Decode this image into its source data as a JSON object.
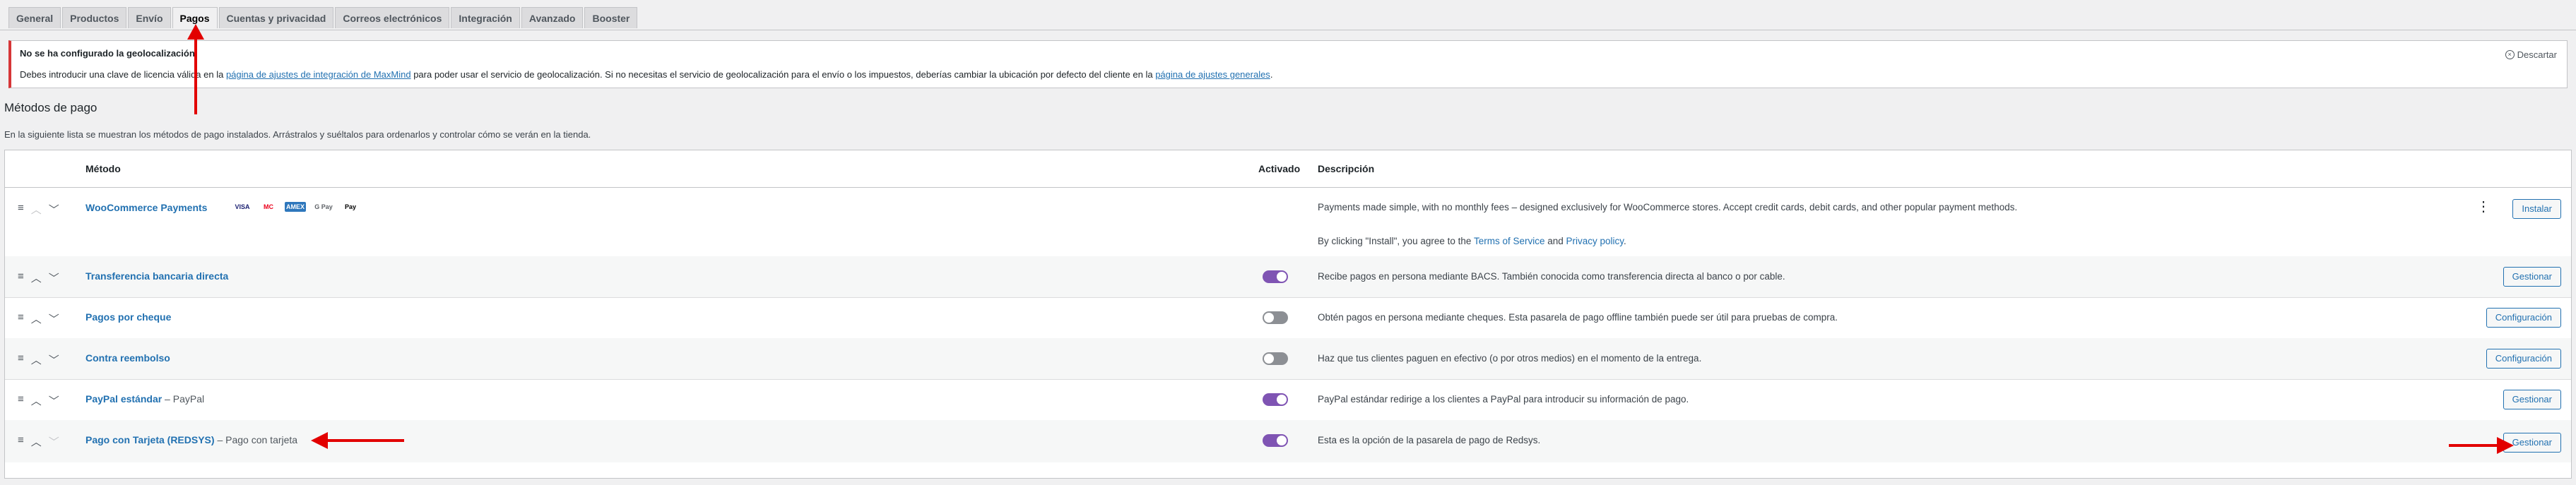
{
  "tabs": [
    {
      "label": "General"
    },
    {
      "label": "Productos"
    },
    {
      "label": "Envío"
    },
    {
      "label": "Pagos",
      "active": true
    },
    {
      "label": "Cuentas y privacidad"
    },
    {
      "label": "Correos electrónicos"
    },
    {
      "label": "Integración"
    },
    {
      "label": "Avanzado"
    },
    {
      "label": "Booster"
    }
  ],
  "notice": {
    "title": "No se ha configurado la geolocalización.",
    "text_1": "Debes introducir una clave de licencia válida en la ",
    "link_1": "página de ajustes de integración de MaxMind",
    "text_2": " para poder usar el servicio de geolocalización. Si no necesitas el servicio de geolocalización para el envío o los impuestos, deberías cambiar la ubicación por defecto del cliente en la ",
    "link_2": "página de ajustes generales",
    "text_3": ".",
    "dismiss": "Descartar"
  },
  "section": {
    "title": "Métodos de pago",
    "intro": "En la siguiente lista se muestran los métodos de pago instalados. Arrástralos y suéltalos para ordenarlos y controlar cómo se verán en la tienda."
  },
  "table": {
    "headers": {
      "method": "Método",
      "enabled": "Activado",
      "description": "Descripción"
    },
    "wcpay": {
      "name": "WooCommerce Payments",
      "cards": [
        "VISA",
        "MC",
        "AMEX",
        "G Pay",
        "Pay"
      ],
      "desc_1": "Payments made simple, with no monthly fees – designed exclusively for WooCommerce stores. Accept credit cards, debit cards, and other popular payment methods.",
      "desc_2a": "By clicking \"Install\", you agree to the ",
      "tos": "Terms of Service",
      "and": " and ",
      "privacy": "Privacy policy",
      "dot": ".",
      "button": "Instalar"
    },
    "rows": [
      {
        "name": "Transferencia bancaria directa",
        "sub": "",
        "enabled": true,
        "desc": "Recibe pagos en persona mediante BACS. También conocida como transferencia directa al banco o por cable.",
        "button": "Gestionar"
      },
      {
        "name": "Pagos por cheque",
        "sub": "",
        "enabled": false,
        "desc": "Obtén pagos en persona mediante cheques. Esta pasarela de pago offline también puede ser útil para pruebas de compra.",
        "button": "Configuración"
      },
      {
        "name": "Contra reembolso",
        "sub": "",
        "enabled": false,
        "desc": "Haz que tus clientes paguen en efectivo (o por otros medios) en el momento de la entrega.",
        "button": "Configuración"
      },
      {
        "name": "PayPal estándar",
        "sub": " – PayPal",
        "enabled": true,
        "desc": "PayPal estándar redirige a los clientes a PayPal para introducir su información de pago.",
        "button": "Gestionar"
      },
      {
        "name": "Pago con Tarjeta (REDSYS)",
        "sub": " – Pago con tarjeta",
        "enabled": true,
        "desc": "Esta es la opción de la pasarela de pago de Redsys.",
        "button": "Gestionar"
      }
    ]
  },
  "colors": {
    "accent": "#2271b1",
    "toggle_on": "#7f54b3",
    "annotation": "#e20000"
  }
}
